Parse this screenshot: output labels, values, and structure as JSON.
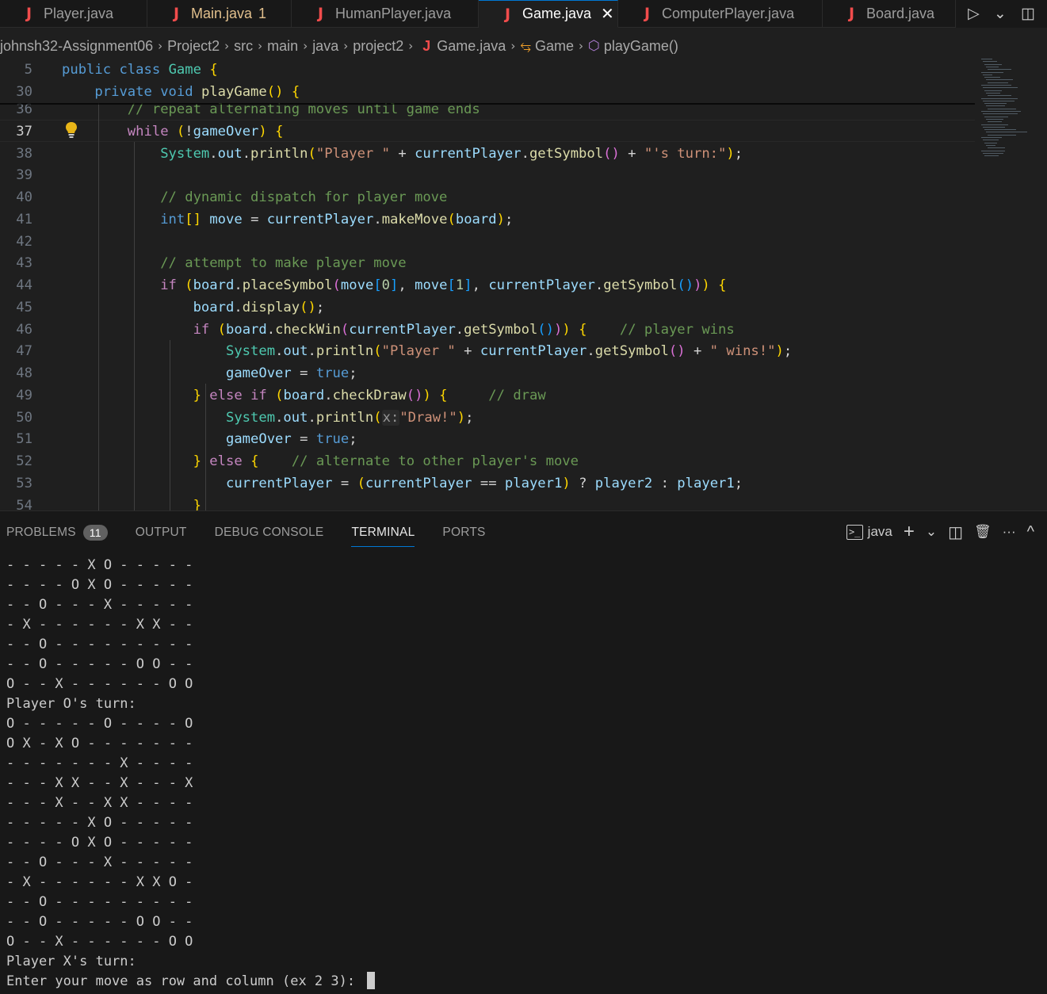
{
  "tabs": [
    {
      "label": "Player.java",
      "modified": false,
      "active": false,
      "badge": ""
    },
    {
      "label": "Main.java",
      "modified": true,
      "active": false,
      "badge": "1"
    },
    {
      "label": "HumanPlayer.java",
      "modified": false,
      "active": false,
      "badge": ""
    },
    {
      "label": "Game.java",
      "modified": false,
      "active": true,
      "badge": ""
    },
    {
      "label": "ComputerPlayer.java",
      "modified": false,
      "active": false,
      "badge": ""
    },
    {
      "label": "Board.java",
      "modified": false,
      "active": false,
      "badge": ""
    }
  ],
  "tab_icon": "J",
  "tab_close": "✕",
  "tab_actions": {
    "run": "▷",
    "run_menu": "⌄",
    "split": "◫"
  },
  "breadcrumb": {
    "items": [
      "johnsh32-Assignment06",
      "Project2",
      "src",
      "main",
      "java",
      "project2"
    ],
    "file": "Game.java",
    "class_name": "Game",
    "method": "playGame()",
    "separator": "›",
    "file_icon": "J",
    "class_icon": "⥃",
    "method_icon": "⬡"
  },
  "sticky": [
    {
      "n": "5",
      "code": "public class Game {"
    },
    {
      "n": "30",
      "code": "    private void playGame() {"
    }
  ],
  "lines": [
    {
      "n": "36",
      "code": "        // repeat alternating moves until game ends"
    },
    {
      "n": "37",
      "code": "        while (!gameOver) {"
    },
    {
      "n": "38",
      "code": "            System.out.println(\"Player \" + currentPlayer.getSymbol() + \"'s turn:\");"
    },
    {
      "n": "39",
      "code": ""
    },
    {
      "n": "40",
      "code": "            // dynamic dispatch for player move"
    },
    {
      "n": "41",
      "code": "            int[] move = currentPlayer.makeMove(board);"
    },
    {
      "n": "42",
      "code": ""
    },
    {
      "n": "43",
      "code": "            // attempt to make player move"
    },
    {
      "n": "44",
      "code": "            if (board.placeSymbol(move[0], move[1], currentPlayer.getSymbol())) {"
    },
    {
      "n": "45",
      "code": "                board.display();"
    },
    {
      "n": "46",
      "code": "                if (board.checkWin(currentPlayer.getSymbol())) {    // player wins"
    },
    {
      "n": "47",
      "code": "                    System.out.println(\"Player \" + currentPlayer.getSymbol() + \" wins!\");"
    },
    {
      "n": "48",
      "code": "                    gameOver = true;"
    },
    {
      "n": "49",
      "code": "                } else if (board.checkDraw()) {     // draw"
    },
    {
      "n": "50",
      "code": "                    System.out.println(x:\"Draw!\");"
    },
    {
      "n": "51",
      "code": "                    gameOver = true;"
    },
    {
      "n": "52",
      "code": "                } else {    // alternate to other player's move"
    },
    {
      "n": "53",
      "code": "                    currentPlayer = (currentPlayer == player1) ? player2 : player1;"
    },
    {
      "n": "54",
      "code": "                }"
    }
  ],
  "panel": {
    "tabs": [
      "PROBLEMS",
      "OUTPUT",
      "DEBUG CONSOLE",
      "TERMINAL",
      "PORTS"
    ],
    "problems_count": "11",
    "active_tab": "TERMINAL",
    "shell": "java",
    "actions": {
      "add": "+",
      "add_menu": "⌄",
      "split": "◫",
      "trash": "🗑",
      "more": "···",
      "maximize": "^"
    }
  },
  "terminal_lines": [
    "- - - - - X O - - - - -",
    "- - - - O X O - - - - -",
    "- - O - - - X - - - - -",
    "- X - - - - - - X X - -",
    "- - O - - - - - - - - -",
    "- - O - - - - - O O - -",
    "O - - X - - - - - - O O",
    "Player O's turn:",
    "O - - - - - O - - - - O",
    "O X - X O - - - - - - -",
    "- - - - - - - X - - - -",
    "- - - X X - - X - - - X",
    "- - - X - - X X - - - -",
    "- - - - - X O - - - - -",
    "- - - - O X O - - - - -",
    "- - O - - - X - - - - -",
    "- X - - - - - - X X O -",
    "- - O - - - - - - - - -",
    "- - O - - - - - O O - -",
    "O - - X - - - - - - O O",
    "Player X's turn:",
    "Enter your move as row and column (ex 2 3): "
  ]
}
